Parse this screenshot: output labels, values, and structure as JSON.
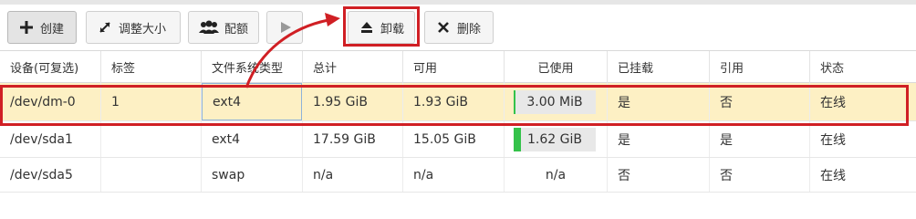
{
  "toolbar": {
    "create": "创建",
    "resize": "调整大小",
    "quota": "配额",
    "eject": "卸载",
    "delete": "删除"
  },
  "table": {
    "headers": [
      "设备(可复选)",
      "标签",
      "文件系统类型",
      "总计",
      "可用",
      "已使用",
      "已挂载",
      "引用",
      "状态"
    ],
    "rows": [
      {
        "device": "/dev/dm-0",
        "label": "1",
        "fs": "ext4",
        "total": "1.95 GiB",
        "avail": "1.93 GiB",
        "used": "3.00 MiB",
        "used_fraction": 0.0015,
        "mounted": "是",
        "ref": "否",
        "status": "在线"
      },
      {
        "device": "/dev/sda1",
        "label": "",
        "fs": "ext4",
        "total": "17.59 GiB",
        "avail": "15.05 GiB",
        "used": "1.62 GiB",
        "used_fraction": 0.09,
        "mounted": "是",
        "ref": "是",
        "status": "在线"
      },
      {
        "device": "/dev/sda5",
        "label": "",
        "fs": "swap",
        "total": "n/a",
        "avail": "n/a",
        "used": "n/a",
        "mounted": "否",
        "ref": "否",
        "status": "在线"
      }
    ]
  },
  "colors": {
    "highlight": "#d01f24",
    "selected_row": "#fdf0c4",
    "usage_bar": "#34c24a"
  }
}
